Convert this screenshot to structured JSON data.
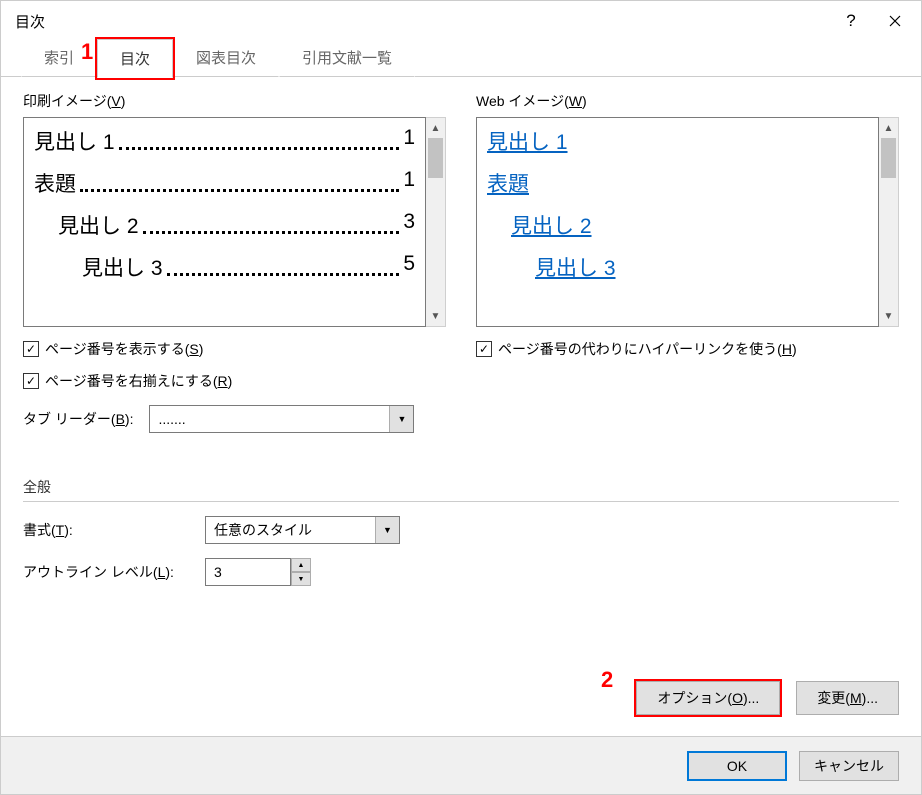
{
  "dialog": {
    "title": "目次"
  },
  "annotations": {
    "one": "1",
    "two": "2"
  },
  "tabs": {
    "index": "索引",
    "toc": "目次",
    "fig": "図表目次",
    "cite": "引用文献一覧"
  },
  "labels": {
    "print_preview": "印刷イメージ(",
    "print_preview_key": "V",
    "print_preview_close": ")",
    "web_preview": "Web イメージ(",
    "web_preview_key": "W",
    "web_preview_close": ")",
    "show_pagenum": "ページ番号を表示する(",
    "show_pagenum_key": "S",
    "show_pagenum_close": ")",
    "right_align": "ページ番号を右揃えにする(",
    "right_align_key": "R",
    "right_align_close": ")",
    "hyperlink": "ページ番号の代わりにハイパーリンクを使う(",
    "hyperlink_key": "H",
    "hyperlink_close": ")",
    "tab_leader": "タブ リーダー(",
    "tab_leader_key": "B",
    "tab_leader_close": "):",
    "general": "全般",
    "format": "書式(",
    "format_key": "T",
    "format_close": "):",
    "outline": "アウトライン レベル(",
    "outline_key": "L",
    "outline_close": "):",
    "options": "オプション(",
    "options_key": "O",
    "options_close": ")...",
    "modify": "変更(",
    "modify_key": "M",
    "modify_close": ")...",
    "ok": "OK",
    "cancel": "キャンセル"
  },
  "toc_preview": [
    {
      "text": "見出し 1",
      "page": "1",
      "indent": 0
    },
    {
      "text": "表題",
      "page": "1",
      "indent": 0
    },
    {
      "text": "見出し 2",
      "page": "3",
      "indent": 1
    },
    {
      "text": "見出し 3",
      "page": "5",
      "indent": 2
    }
  ],
  "web_preview": [
    {
      "text": "見出し 1",
      "indent": 0
    },
    {
      "text": "表題",
      "indent": 0
    },
    {
      "text": "見出し 2",
      "indent": 1
    },
    {
      "text": "見出し 3",
      "indent": 2
    }
  ],
  "values": {
    "tab_leader": ".......",
    "format": "任意のスタイル",
    "outline_level": "3",
    "check": "✓"
  }
}
